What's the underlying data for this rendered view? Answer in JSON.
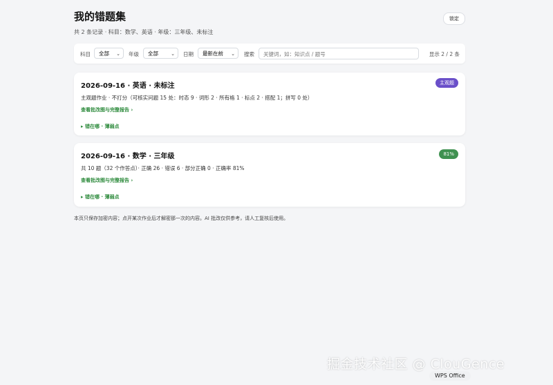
{
  "header": {
    "title": "我的错题集",
    "subtitle": "共 2 条记录 · 科目：数学、英语 · 年级：三年级、未标注",
    "lock_label": "锁定"
  },
  "filters": {
    "subject_label": "科目",
    "subject_value": "全部",
    "grade_label": "年级",
    "grade_value": "全部",
    "date_label": "日期",
    "date_value": "最新在前",
    "search_label": "搜索",
    "search_placeholder": "关键词，如：知识点 / 题号",
    "count_text": "显示 2 / 2 条"
  },
  "records": [
    {
      "title": "2026-09-16 · 英语 · 未标注",
      "desc": "主观题作业 · 不打分（可核实问题 15 处：时态 9 · 词形 2 · 所有格 1 · 标点 2 · 搭配 1；拼写 0 处）",
      "link": "查看批改图与完整报告 ›",
      "toggle": "▸ 错在哪 · 薄弱点",
      "badge": "主观题",
      "badge_color": "#6a4fc9"
    },
    {
      "title": "2026-09-16 · 数学 · 三年级",
      "desc": "共 10 题（32 个作答点）· 正确 26 · 错误 6 · 部分正确 0 · 正确率 81%",
      "link": "查看批改图与完整报告 ›",
      "toggle": "▸ 错在哪 · 薄弱点",
      "badge": "81%",
      "badge_color": "#3f9150"
    }
  ],
  "footnote": "本页只保存加密内容；点开某次作业后才解密那一次的内容。AI 批改仅供参考，请人工复核后使用。",
  "watermark": "掘金技术社区 @ ClouGence",
  "wps_label": "WPS Office"
}
